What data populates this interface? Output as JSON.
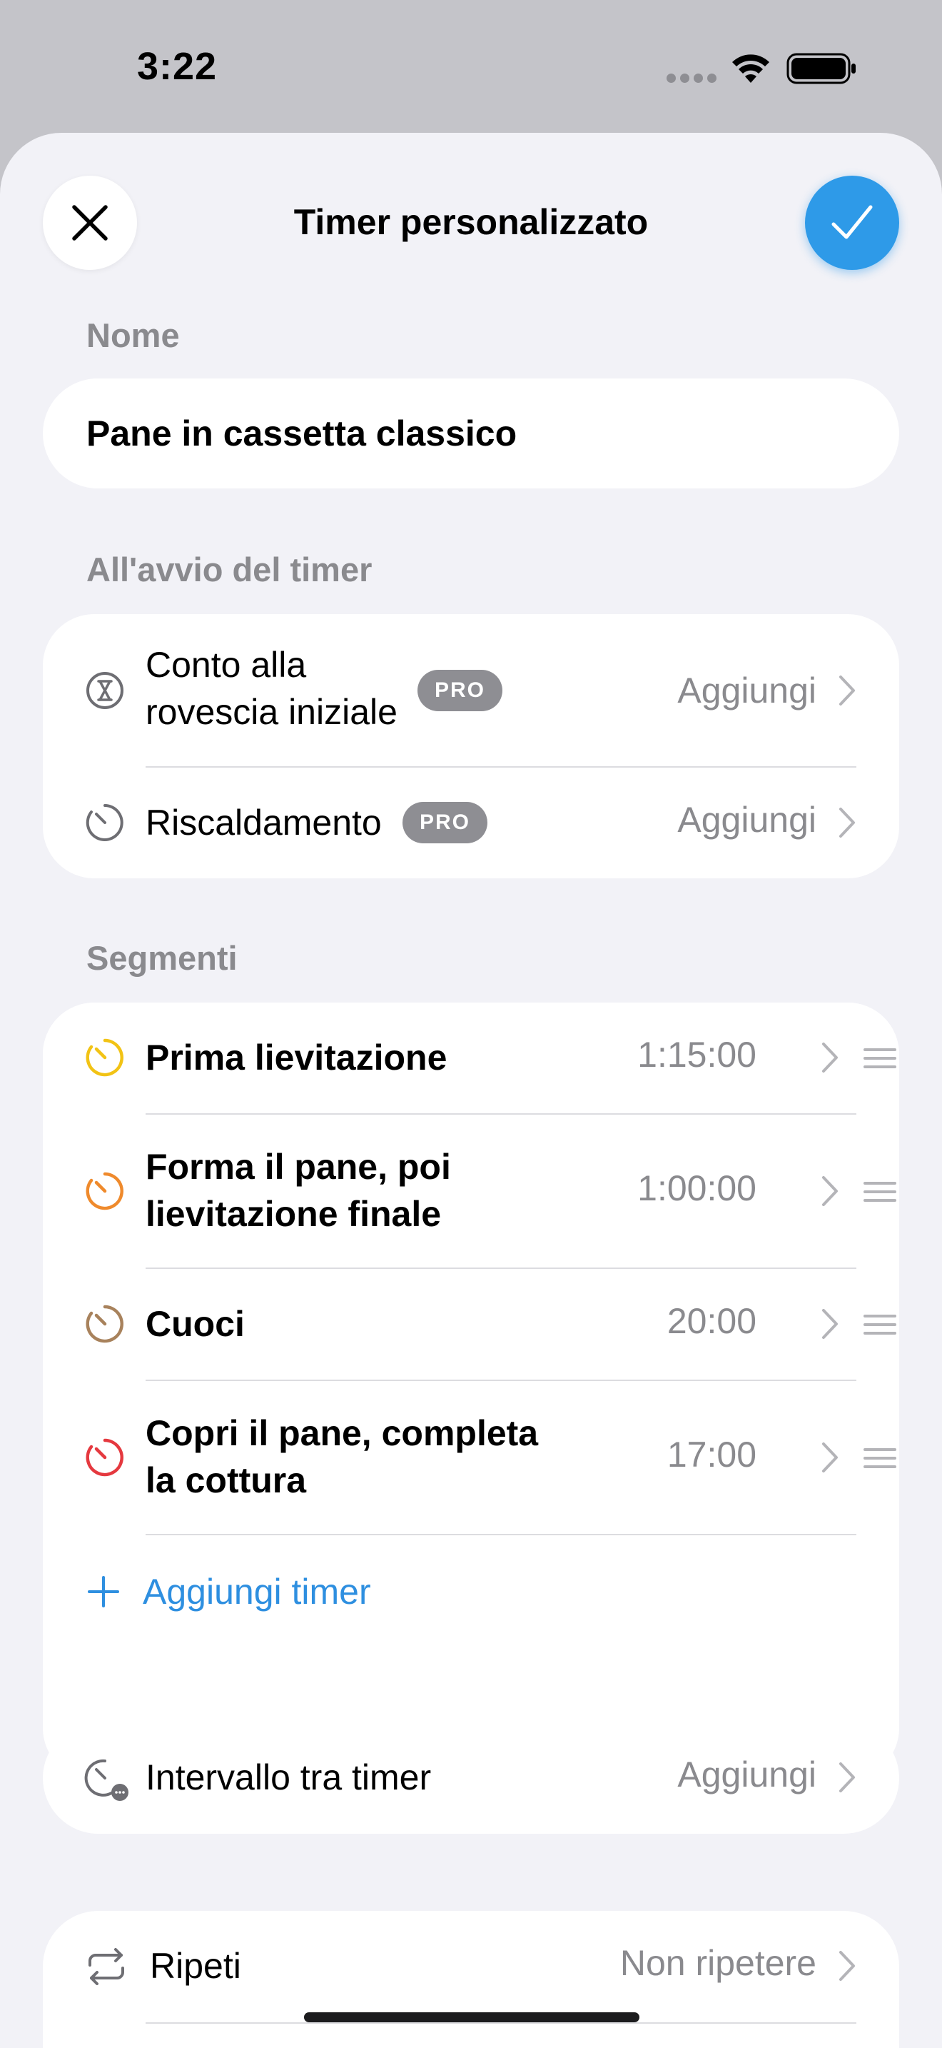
{
  "status_bar": {
    "time": "3:22"
  },
  "header": {
    "title": "Timer personalizzato"
  },
  "name_section": {
    "label": "Nome",
    "value": "Pane in cassetta classico"
  },
  "start_section": {
    "label": "All'avvio del timer",
    "items": [
      {
        "label_line1": "Conto alla",
        "label_line2": "rovescia iniziale",
        "badge": "PRO",
        "value": "Aggiungi",
        "icon": "hourglass-icon"
      },
      {
        "label": "Riscaldamento",
        "badge": "PRO",
        "value": "Aggiungi",
        "icon": "timer-icon"
      }
    ]
  },
  "segments_section": {
    "label": "Segmenti",
    "items": [
      {
        "label": "Prima lievitazione",
        "time": "1:15:00",
        "color": "#f2c315"
      },
      {
        "label_line1": "Forma il pane, poi",
        "label_line2": "lievitazione finale",
        "time": "1:00:00",
        "color": "#ef8a2c"
      },
      {
        "label": "Cuoci",
        "time": "20:00",
        "color": "#a8825c"
      },
      {
        "label_line1": "Copri il pane, completa",
        "label_line2": "la cottura",
        "time": "17:00",
        "color": "#e5393f"
      }
    ],
    "add_label": "Aggiungi timer"
  },
  "interval": {
    "label": "Intervallo tra timer",
    "value": "Aggiungi",
    "icon": "interval-timer-icon"
  },
  "repeat": {
    "label": "Ripeti",
    "value": "Non ripetere",
    "icon": "repeat-icon"
  },
  "colors": {
    "accent": "#2e9ae8",
    "link": "#2e8fe0",
    "badge": "#8e8e93"
  }
}
